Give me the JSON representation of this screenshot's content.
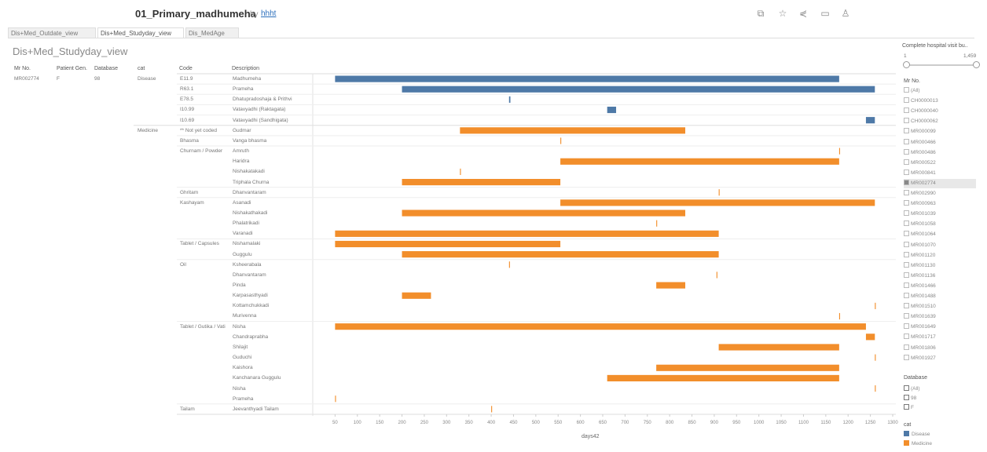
{
  "workbook": {
    "title": "01_Primary_madhumeha",
    "by": "by",
    "author": "hhht"
  },
  "toolbar_icons": [
    "duplicate-icon",
    "star-icon",
    "share-icon",
    "comment-icon",
    "user-icon"
  ],
  "tabs": [
    {
      "label": "Dis+Med_Outdate_view"
    },
    {
      "label": "Dis+Med_Studyday_view",
      "active": true
    },
    {
      "label": "Dis_MedAge"
    }
  ],
  "sheet_title": "Dis+Med_Studyday_view",
  "columns": {
    "mr": "Mr No.",
    "gender": "Patient Gen.",
    "database": "Database",
    "cat": "cat",
    "code": "Code",
    "description": "Description"
  },
  "patient": {
    "mr": "MR002774",
    "gender": "F",
    "database": "98",
    "cat": "Disease"
  },
  "groups": [
    {
      "cat": "Disease",
      "code_groups": [
        {
          "code": "E11.9",
          "rows": [
            {
              "d": "Madhumeha",
              "bars": [
                [
                  50,
                  1180
                ]
              ],
              "type": "Disease"
            }
          ]
        },
        {
          "code": "R63.1",
          "rows": [
            {
              "d": "Prameha",
              "bars": [
                [
                  200,
                  1260
                ]
              ],
              "type": "Disease"
            }
          ]
        },
        {
          "code": "E78.5",
          "rows": [
            {
              "d": "Dhatupradoshaja & Prithvi",
              "bars": [
                [
                  440,
                  443
                ]
              ],
              "type": "Disease"
            }
          ]
        },
        {
          "code": "I10.99",
          "rows": [
            {
              "d": "Vatavyadhi (Raktagata)",
              "bars": [
                [
                  660,
                  680
                ]
              ],
              "type": "Disease"
            }
          ]
        },
        {
          "code": "I10.69",
          "rows": [
            {
              "d": "Vatavyadhi (Sandhigata)",
              "bars": [
                [
                  1240,
                  1260
                ]
              ],
              "type": "Disease"
            }
          ]
        }
      ]
    },
    {
      "cat": "Medicine",
      "code_groups": [
        {
          "code": "** Not yet coded",
          "rows": [
            {
              "d": "Gudmar",
              "bars": [
                [
                  330,
                  835
                ]
              ],
              "type": "Medicine"
            }
          ]
        },
        {
          "code": "Bhasma",
          "rows": [
            {
              "d": "Vanga bhasma",
              "bars": [
                [
                  555,
                  557
                ]
              ],
              "type": "Medicine"
            }
          ]
        },
        {
          "code": "Churnam / Powder",
          "rows": [
            {
              "d": "Amruth",
              "bars": [
                [
                  1180,
                  1182
                ]
              ],
              "type": "Medicine"
            },
            {
              "d": "Haridra",
              "bars": [
                [
                  555,
                  1180
                ]
              ],
              "type": "Medicine"
            },
            {
              "d": "Nishakatakadi",
              "bars": [
                [
                  330,
                  332
                ]
              ],
              "type": "Medicine"
            },
            {
              "d": "Triphala Churna",
              "bars": [
                [
                  200,
                  555
                ]
              ],
              "type": "Medicine"
            }
          ]
        },
        {
          "code": "Ghritam",
          "rows": [
            {
              "d": "Dhanvantaram",
              "bars": [
                [
                  910,
                  912
                ]
              ],
              "type": "Medicine"
            }
          ]
        },
        {
          "code": "Kashayam",
          "rows": [
            {
              "d": "Asanadi",
              "bars": [
                [
                  555,
                  1260
                ]
              ],
              "type": "Medicine"
            },
            {
              "d": "Nishakathakadi",
              "bars": [
                [
                  200,
                  835
                ]
              ],
              "type": "Medicine"
            },
            {
              "d": "Phalatrikadi",
              "bars": [
                [
                  770,
                  772
                ]
              ],
              "type": "Medicine"
            },
            {
              "d": "Varanadi",
              "bars": [
                [
                  50,
                  910
                ]
              ],
              "type": "Medicine"
            }
          ]
        },
        {
          "code": "Tablet / Capsules",
          "rows": [
            {
              "d": "Nishamalaki",
              "bars": [
                [
                  50,
                  555
                ]
              ],
              "type": "Medicine"
            },
            {
              "d": "Guggulu",
              "bars": [
                [
                  200,
                  910
                ]
              ],
              "type": "Medicine"
            }
          ]
        },
        {
          "code": "Oil",
          "rows": [
            {
              "d": "Ksheerabala",
              "bars": [
                [
                  440,
                  442
                ]
              ],
              "type": "Medicine"
            },
            {
              "d": "Dhanvantaram",
              "bars": [
                [
                  905,
                  907
                ]
              ],
              "type": "Medicine"
            },
            {
              "d": "Pinda",
              "bars": [
                [
                  770,
                  835
                ]
              ],
              "type": "Medicine"
            },
            {
              "d": "Karpasasthyadi",
              "bars": [
                [
                  200,
                  265
                ]
              ],
              "type": "Medicine"
            },
            {
              "d": "Kottamchukkadi",
              "bars": [
                [
                  1260,
                  1262
                ]
              ],
              "type": "Medicine"
            },
            {
              "d": "Murivenna",
              "bars": [
                [
                  1180,
                  1182
                ]
              ],
              "type": "Medicine"
            }
          ]
        },
        {
          "code": "Tablet / Gutika / Vati",
          "rows": [
            {
              "d": "Nisha",
              "bars": [
                [
                  50,
                  1240
                ]
              ],
              "type": "Medicine"
            },
            {
              "d": "Chandraprabha",
              "bars": [
                [
                  1240,
                  1260
                ]
              ],
              "type": "Medicine"
            },
            {
              "d": "Shilajit",
              "bars": [
                [
                  910,
                  1180
                ]
              ],
              "type": "Medicine"
            },
            {
              "d": "Guduchi",
              "bars": [
                [
                  1260,
                  1262
                ]
              ],
              "type": "Medicine"
            },
            {
              "d": "Kaishora",
              "bars": [
                [
                  770,
                  1180
                ]
              ],
              "type": "Medicine"
            },
            {
              "d": "Kanchanara Guggulu",
              "bars": [
                [
                  660,
                  1180
                ]
              ],
              "type": "Medicine"
            },
            {
              "d": "Nisha",
              "bars": [
                [
                  1260,
                  1262
                ]
              ],
              "type": "Medicine"
            },
            {
              "d": "Prameha",
              "bars": [
                [
                  50,
                  52
                ]
              ],
              "type": "Medicine"
            }
          ]
        },
        {
          "code": "Tailam",
          "rows": [
            {
              "d": "Jeevanthyadi Tailam",
              "bars": [
                [
                  400,
                  402
                ]
              ],
              "type": "Medicine"
            }
          ]
        }
      ]
    }
  ],
  "chart_data": {
    "type": "bar",
    "orientation": "horizontal-gantt",
    "xlabel": "days42",
    "xlim": [
      0,
      1300
    ],
    "xticks": [
      "50",
      "100",
      "150",
      "200",
      "250",
      "300",
      "350",
      "400",
      "450",
      "500",
      "550",
      "600",
      "650",
      "700",
      "750",
      "800",
      "850",
      "900",
      "950",
      "1000",
      "1050",
      "1100",
      "1150",
      "1200",
      "1250",
      "1300"
    ],
    "series_colors": {
      "Disease": "#4e79a7",
      "Medicine": "#f28e2b"
    }
  },
  "sidebar": {
    "slider": {
      "title": "Complete hospital visit bu..",
      "min": "1",
      "max": "1,459"
    },
    "mr_filter_title": "Mr No.",
    "mr_items": [
      "(All)",
      "CH0000013",
      "CH0000040",
      "CH0000062",
      "MR000099",
      "MR000466",
      "MR000486",
      "MR000522",
      "MR000841",
      "MR002774",
      "MR002990",
      "MR000963",
      "MR001039",
      "MR001058",
      "MR001064",
      "MR001070",
      "MR001120",
      "MR001130",
      "MR001136",
      "MR001466",
      "MR001488",
      "MR001510",
      "MR001639",
      "MR001649",
      "MR001717",
      "MR001806",
      "MR001927"
    ],
    "mr_selected": "MR002774",
    "database_title": "Database",
    "database_items": [
      "(All)",
      "98",
      "F"
    ],
    "cat_title": "cat",
    "cat_items": [
      "Disease",
      "Medicine"
    ]
  }
}
